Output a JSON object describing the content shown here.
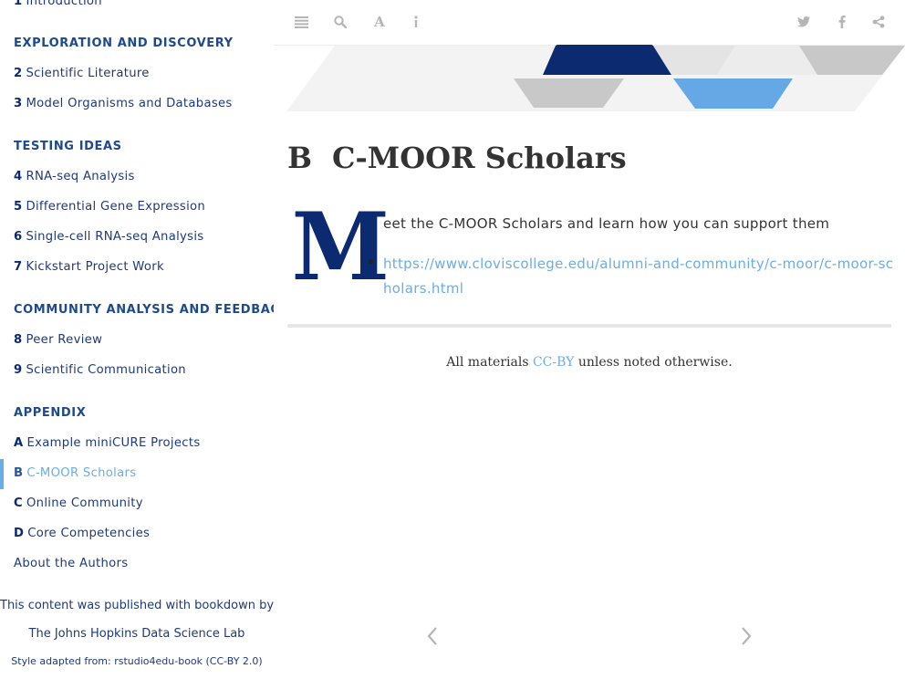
{
  "sidebar": {
    "top_partial": {
      "num": "1",
      "label": "Introduction"
    },
    "sections": [
      {
        "label": "EXPLORATION AND DISCOVERY"
      },
      {
        "label": "TESTING IDEAS"
      },
      {
        "label": "COMMUNITY ANALYSIS AND FEEDBACK"
      },
      {
        "label": "APPENDIX"
      }
    ],
    "items": [
      {
        "num": "2",
        "label": "Scientific Literature"
      },
      {
        "num": "3",
        "label": "Model Organisms and Databases"
      },
      {
        "num": "4",
        "label": "RNA-seq Analysis"
      },
      {
        "num": "5",
        "label": "Differential Gene Expression"
      },
      {
        "num": "6",
        "label": "Single-cell RNA-seq Analysis"
      },
      {
        "num": "7",
        "label": "Kickstart Project Work"
      },
      {
        "num": "8",
        "label": "Peer Review"
      },
      {
        "num": "9",
        "label": "Scientific Communication"
      },
      {
        "num": "A",
        "label": "Example miniCURE Projects"
      },
      {
        "num": "B",
        "label": "C-MOOR Scholars"
      },
      {
        "num": "C",
        "label": "Online Community"
      },
      {
        "num": "D",
        "label": "Core Competencies"
      }
    ],
    "about": "About the Authors",
    "published_by": "This content was published with bookdown by:",
    "lab": "The Johns Hopkins Data Science Lab",
    "style_credit": "Style adapted from: rstudio4edu-book (CC-BY 2.0)"
  },
  "toolbar": {
    "left_icons": [
      "menu-icon",
      "search-icon",
      "font-icon",
      "info-icon"
    ],
    "right_icons": [
      "twitter-icon",
      "facebook-icon",
      "share-icon"
    ]
  },
  "page": {
    "chapter_num": "B",
    "chapter_title": "C-MOOR Scholars",
    "dropcap": "M",
    "lead_rest": "eet the C-MOOR Scholars and learn how you can support them",
    "links": [
      "https://www.cloviscollege.edu/alumni-and-community/c-moor/c-moor-scholars.html"
    ],
    "footer_prefix": "All materials",
    "footer_link": "CC-BY",
    "footer_suffix": "unless noted otherwise."
  },
  "colors": {
    "navy": "#0b2a6f",
    "link_blue": "#6aaee6",
    "section_blue": "#1e4a8c",
    "banner_gray": "#c8c8c8",
    "banner_light": "#efefef"
  }
}
